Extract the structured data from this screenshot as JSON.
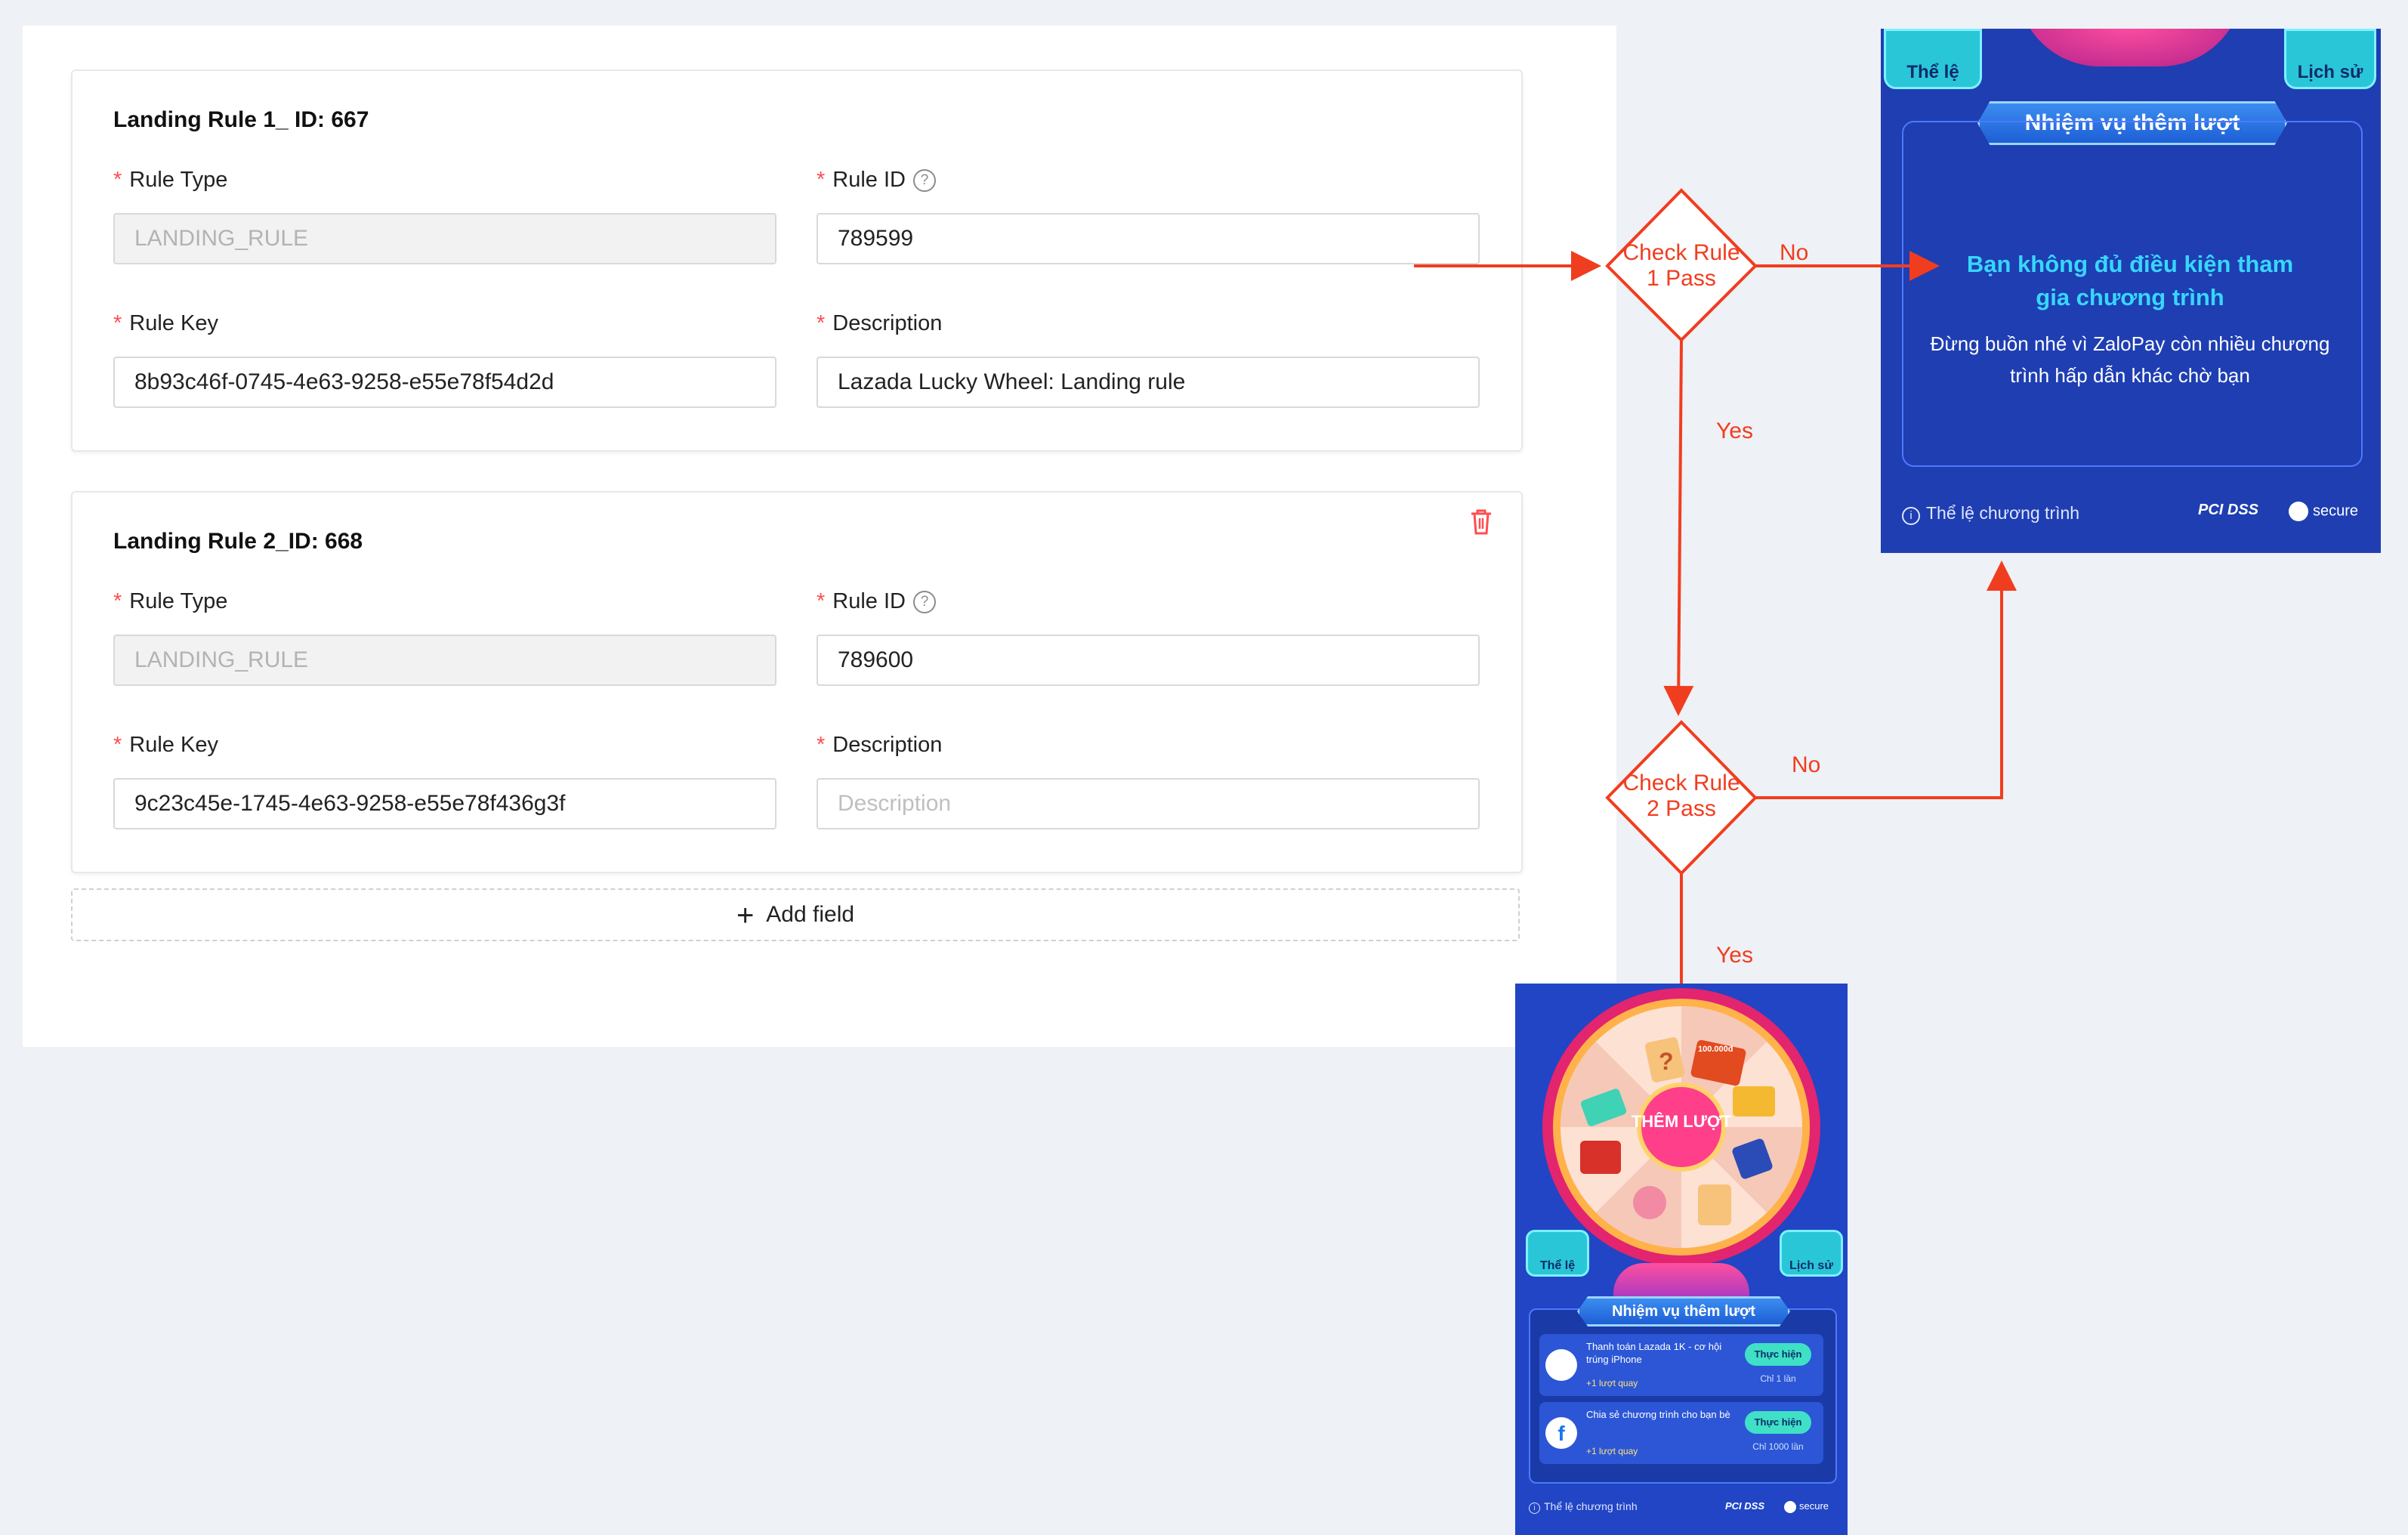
{
  "card1": {
    "title": "Landing Rule 1_ ID: 667",
    "rule_type_label": "Rule Type",
    "rule_type_value": "LANDING_RULE",
    "rule_id_label": "Rule ID",
    "rule_id_value": "789599",
    "rule_key_label": "Rule Key",
    "rule_key_value": "8b93c46f-0745-4e63-9258-e55e78f54d2d",
    "description_label": "Description",
    "description_value": "Lazada Lucky Wheel: Landing rule"
  },
  "card2": {
    "title": "Landing Rule 2_ID: 668",
    "rule_type_label": "Rule Type",
    "rule_type_value": "LANDING_RULE",
    "rule_id_label": "Rule ID",
    "rule_id_value": "789600",
    "rule_key_label": "Rule Key",
    "rule_key_value": "9c23c45e-1745-4e63-9258-e55e78f436g3f",
    "description_label": "Description",
    "description_placeholder": "Description"
  },
  "add_field_label": "Add field",
  "flow": {
    "check1": "Check Rule 1 Pass",
    "check2": "Check Rule 2 Pass",
    "no1": "No",
    "no2": "No",
    "yes1": "Yes",
    "yes2": "Yes"
  },
  "phone_fail": {
    "rules_tab": "Thể lệ",
    "history_tab": "Lịch sử",
    "banner": "Nhiệm vụ thêm lượt",
    "headline": "Bạn không đủ điều kiện tham gia chương trình",
    "message": "Đừng buồn nhé vì ZaloPay còn nhiều chương trình hấp dẫn khác chờ bạn",
    "terms_link": "Thể lệ chương trình",
    "badge_pci": "PCI DSS",
    "badge_secure": "secure"
  },
  "phone_pass": {
    "wheel_center": "THÊM LƯỢT",
    "prize_label": "100.000đ",
    "rules_tab": "Thể lệ",
    "history_tab": "Lịch sử",
    "banner": "Nhiệm vụ thêm lượt",
    "tasks": [
      {
        "title": "Thanh toán Lazada 1K - cơ hội trúng iPhone",
        "reward": "+1 lượt quay",
        "button": "Thực hiện",
        "limit": "Chỉ 1 lần"
      },
      {
        "title": "Chia sẻ chương trình cho bạn bè",
        "reward": "+1 lượt quay",
        "button": "Thực hiện",
        "limit": "Chỉ 1000 lần"
      }
    ],
    "terms_link": "Thể lệ chương trình",
    "badge_pci": "PCI DSS",
    "badge_secure": "secure"
  },
  "colors": {
    "arrow": "#f13d1f",
    "required": "#ff4d4f",
    "phone_bg": "#1e3eb2",
    "headline": "#38d6ff"
  }
}
